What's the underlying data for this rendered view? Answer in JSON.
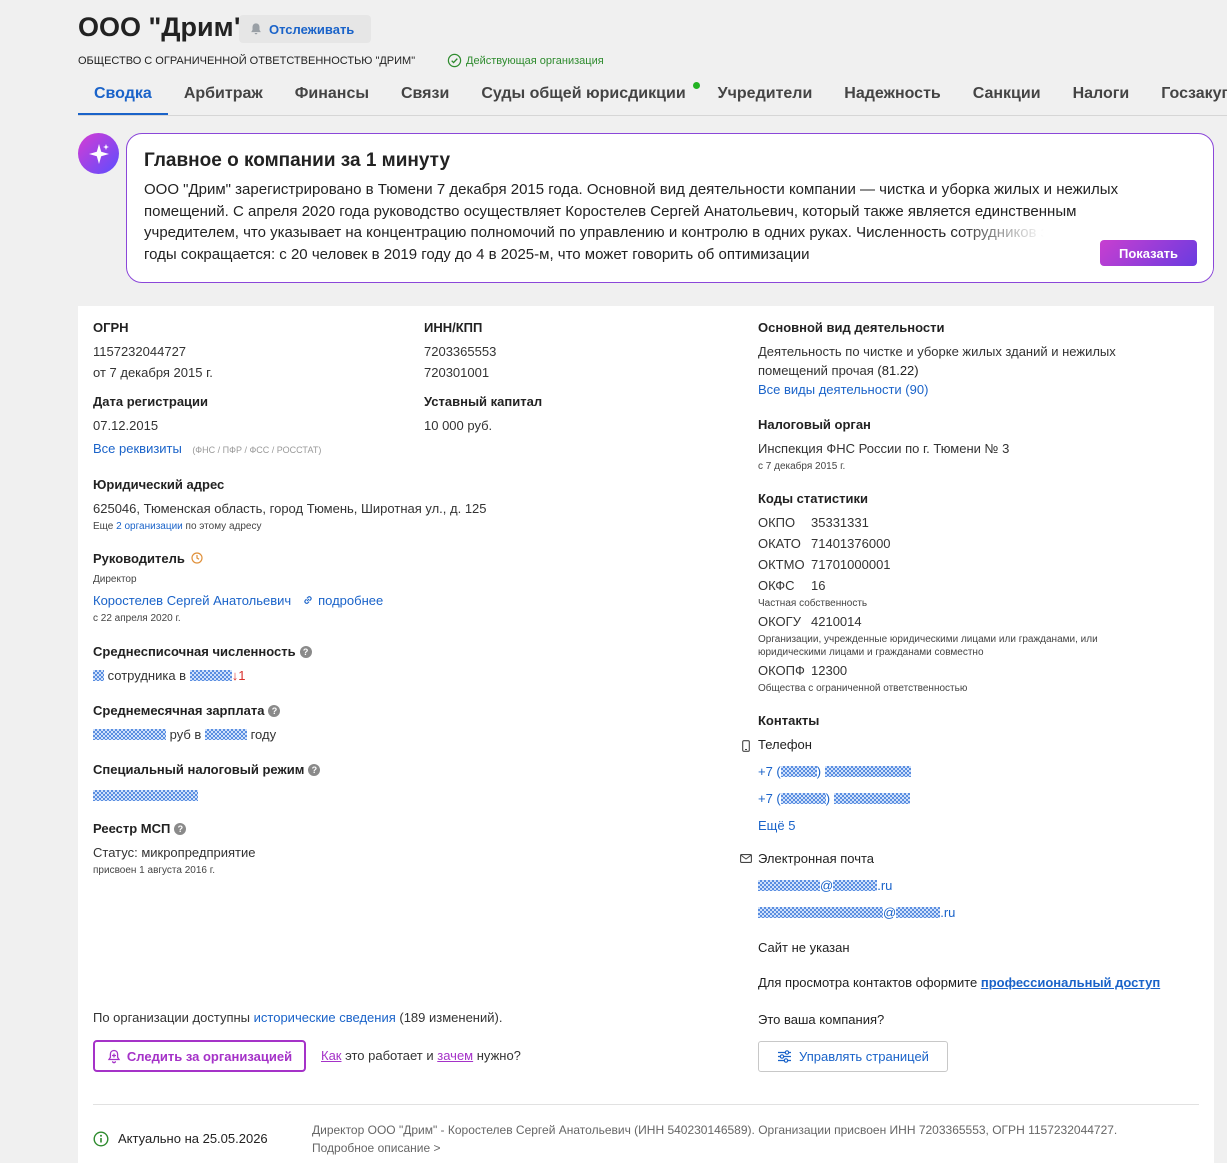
{
  "header": {
    "title": "ООО \"Дрим\"",
    "track_label": "Отслеживать",
    "full_name": "ОБЩЕСТВО С ОГРАНИЧЕННОЙ ОТВЕТСТВЕННОСТЬЮ \"ДРИМ\"",
    "status": "Действующая организация"
  },
  "tabs": [
    {
      "label": "Сводка"
    },
    {
      "label": "Арбитраж"
    },
    {
      "label": "Финансы"
    },
    {
      "label": "Связи"
    },
    {
      "label": "Суды общей юрисдикции"
    },
    {
      "label": "Учредители"
    },
    {
      "label": "Надежность"
    },
    {
      "label": "Санкции"
    },
    {
      "label": "Налоги"
    },
    {
      "label": "Госзакупки"
    }
  ],
  "summary": {
    "title": "Главное о компании за 1 минуту",
    "text": "ООО \"Дрим\" зарегистрировано в Тюмени 7 декабря 2015 года. Основной вид деятельности компании — чистка и уборка жилых и нежилых помещений. С апреля 2020 года руководство осуществляет Коростелев Сергей Анатольевич, который также является единственным учредителем, что указывает на концентрацию полномочий по управлению и контролю в одних руках. Численность сотрудников за последние годы сокращается: с 20 человек в 2019 году до 4 в 2025-м, что может говорить об оптимизации",
    "show_label": "Показать"
  },
  "details": {
    "ogrn_label": "ОГРН",
    "ogrn": "1157232044727",
    "ogrn_date": "от 7 декабря 2015 г.",
    "inn_label": "ИНН/КПП",
    "inn": "7203365553",
    "kpp": "720301001",
    "reg_label": "Дата регистрации",
    "reg_date": "07.12.2015",
    "capital_label": "Уставный капитал",
    "capital": "10 000 руб.",
    "requisites_link": "Все реквизиты",
    "requisites_note": "(ФНС / ПФР / ФСС / РОССТАТ)",
    "address_label": "Юридический адрес",
    "address": "625046, Тюменская область, город Тюмень, Широтная ул., д. 125",
    "address_more_prefix": "Еще",
    "address_more_link": "2 организации",
    "address_more_suffix": "по этому адресу",
    "head_label": "Руководитель",
    "head_role": "Директор",
    "head_name": "Коростелев Сергей Анатольевич",
    "head_more": "подробнее",
    "head_since": "с 22 апреля 2020 г.",
    "staff_label": "Среднесписочная численность",
    "staff_mid": "сотрудника в",
    "staff_change": "↓1",
    "salary_label": "Среднемесячная зарплата",
    "salary_mid": "руб в",
    "salary_end": "году",
    "tax_mode_label": "Специальный налоговый режим",
    "msp_label": "Реестр МСП",
    "msp_status": "Статус: микропредприятие",
    "msp_since": "присвоен 1 августа 2016 г.",
    "history_prefix": "По организации доступны",
    "history_link": "исторические сведения",
    "history_count": "(189 изменений).",
    "follow_label": "Следить за организацией",
    "how_link": "Как",
    "how_mid": "это работает и",
    "why_link": "зачем",
    "why_end": "нужно?"
  },
  "right": {
    "activity_label": "Основной вид деятельности",
    "activity_line1": "Деятельность по чистке и уборке жилых зданий и нежилых",
    "activity_line2": "помещений прочая",
    "activity_code": "(81.22)",
    "activity_all": "Все виды деятельности (90)",
    "tax_label": "Налоговый орган",
    "tax_org": "Инспекция ФНС России по г. Тюмени № 3",
    "tax_since": "с 7 декабря 2015 г.",
    "codes_label": "Коды статистики",
    "okpo_k": "ОКПО",
    "okpo_v": "35331331",
    "okato_k": "ОКАТО",
    "okato_v": "71401376000",
    "oktmo_k": "ОКТМО",
    "oktmo_v": "71701000001",
    "okfs_k": "ОКФС",
    "okfs_v": "16",
    "okfs_note": "Частная собственность",
    "okogu_k": "ОКОГУ",
    "okogu_v": "4210014",
    "okogu_note1": "Организации, учрежденные юридическими лицами или гражданами, или",
    "okogu_note2": "юридическими лицами и гражданами совместно",
    "okopf_k": "ОКОПФ",
    "okopf_v": "12300",
    "okopf_note": "Общества с ограниченной ответственностью",
    "contacts_label": "Контакты",
    "phone_label": "Телефон",
    "phone_prefix": "+7 (",
    "phone_close": ")",
    "phones_more": "Ещё 5",
    "email_label": "Электронная почта",
    "email_at": "@",
    "email_tld": ".ru",
    "site": "Сайт не указан",
    "pro_prefix": "Для просмотра контактов оформите",
    "pro_link": "профессиональный доступ",
    "yours": "Это ваша компания?",
    "manage_label": "Управлять страницей"
  },
  "footer": {
    "actual": "Актуально на 25.05.2026",
    "desc_line1": "Директор ООО \"Дрим\" - Коростелев Сергей Анатольевич (ИНН 540230146589). Организации присвоен ИНН 7203365553, ОГРН 1157232044727.",
    "desc_more": "Подробное описание >"
  },
  "colors": {
    "accent": "#1a63c9",
    "purple": "#a532c8",
    "active_green": "#2e8b2e"
  }
}
